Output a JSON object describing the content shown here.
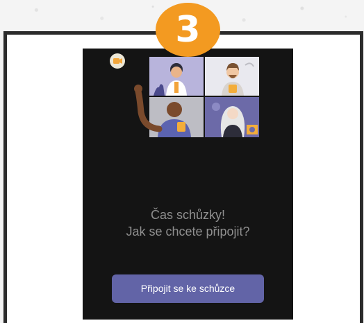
{
  "step_badge": "3",
  "prompt": {
    "line1": "Čas schůzky!",
    "line2": "Jak se chcete připojit?"
  },
  "join_button_label": "Připojit se ke schůzce",
  "icons": [
    "camera-icon",
    "video-call-people-illustration"
  ],
  "colors": {
    "badge": "#f39a21",
    "button": "#6264a7",
    "screen": "#141414",
    "prompt_text": "#8f8f8f"
  }
}
